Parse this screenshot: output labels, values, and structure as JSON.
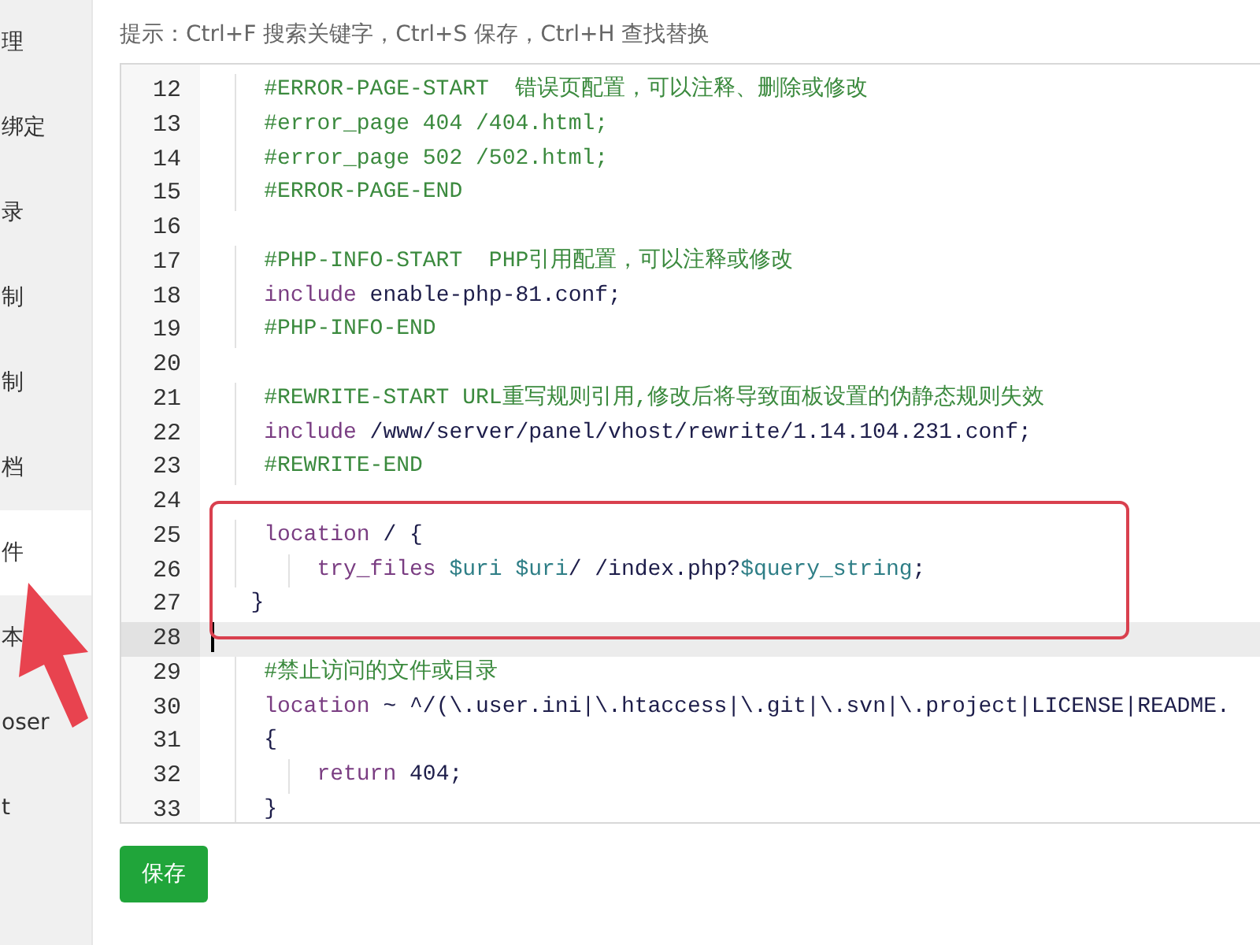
{
  "sidebar": {
    "items": [
      {
        "label": "理",
        "selected": false
      },
      {
        "label": "绑定",
        "selected": false
      },
      {
        "label": "录",
        "selected": false
      },
      {
        "label": "制",
        "selected": false
      },
      {
        "label": "制",
        "selected": false
      },
      {
        "label": "档",
        "selected": false
      },
      {
        "label": "件",
        "selected": true
      },
      {
        "label": "本",
        "selected": false
      },
      {
        "label": "oser",
        "selected": false
      },
      {
        "label": "t",
        "selected": false
      }
    ]
  },
  "hint": "提示：Ctrl+F 搜索关键字，Ctrl+S 保存，Ctrl+H 查找替换",
  "editor": {
    "lines": [
      {
        "number": "12",
        "current": false,
        "tokens": [
          {
            "kind": "comment",
            "text": "    #ERROR-PAGE-START  错误页配置，可以注释、删除或修改"
          }
        ]
      },
      {
        "number": "13",
        "current": false,
        "tokens": [
          {
            "kind": "comment",
            "text": "    #error_page 404 /404.html;"
          }
        ]
      },
      {
        "number": "14",
        "current": false,
        "tokens": [
          {
            "kind": "comment",
            "text": "    #error_page 502 /502.html;"
          }
        ]
      },
      {
        "number": "15",
        "current": false,
        "tokens": [
          {
            "kind": "comment",
            "text": "    #ERROR-PAGE-END"
          }
        ]
      },
      {
        "number": "16",
        "current": false
      },
      {
        "number": "17",
        "current": false,
        "tokens": [
          {
            "kind": "comment",
            "text": "    #PHP-INFO-START  PHP引用配置，可以注释或修改"
          }
        ]
      },
      {
        "number": "18",
        "current": false,
        "tokens": [
          {
            "kind": "keyword",
            "text": "    include"
          },
          {
            "kind": "plain",
            "text": " enable-php-81.conf;"
          }
        ]
      },
      {
        "number": "19",
        "current": false,
        "tokens": [
          {
            "kind": "comment",
            "text": "    #PHP-INFO-END"
          }
        ]
      },
      {
        "number": "20",
        "current": false
      },
      {
        "number": "21",
        "current": false,
        "tokens": [
          {
            "kind": "comment",
            "text": "    #REWRITE-START URL重写规则引用,修改后将导致面板设置的伪静态规则失效"
          }
        ]
      },
      {
        "number": "22",
        "current": false,
        "tokens": [
          {
            "kind": "keyword",
            "text": "    include"
          },
          {
            "kind": "plain",
            "text": " /www/server/panel/vhost/rewrite/1.14.104.231.conf;"
          }
        ]
      },
      {
        "number": "23",
        "current": false,
        "tokens": [
          {
            "kind": "comment",
            "text": "    #REWRITE-END"
          }
        ]
      },
      {
        "number": "24",
        "current": false
      },
      {
        "number": "25",
        "current": false,
        "tokens": [
          {
            "kind": "keyword",
            "text": "    location"
          },
          {
            "kind": "plain",
            "text": " / {"
          }
        ]
      },
      {
        "number": "26",
        "current": false,
        "tokens": [
          {
            "kind": "keyword",
            "text": "        try_files"
          },
          {
            "kind": "variable",
            "text": " $uri"
          },
          {
            "kind": "variable",
            "text": " $uri"
          },
          {
            "kind": "plain",
            "text": "/ /index.php?"
          },
          {
            "kind": "variable",
            "text": "$query_string"
          },
          {
            "kind": "plain",
            "text": ";"
          }
        ]
      },
      {
        "number": "27",
        "current": false,
        "tokens": [
          {
            "kind": "plain",
            "text": "   }"
          }
        ]
      },
      {
        "number": "28",
        "current": true
      },
      {
        "number": "29",
        "current": false,
        "tokens": [
          {
            "kind": "comment",
            "text": "    #禁止访问的文件或目录"
          }
        ]
      },
      {
        "number": "30",
        "current": false,
        "tokens": [
          {
            "kind": "keyword",
            "text": "    location"
          },
          {
            "kind": "plain",
            "text": " ~ ^/(\\.user.ini|\\.htaccess|\\.git|\\.svn|\\.project|LICENSE|README."
          }
        ]
      },
      {
        "number": "31",
        "current": false,
        "tokens": [
          {
            "kind": "plain",
            "text": "    {"
          }
        ]
      },
      {
        "number": "32",
        "current": false,
        "tokens": [
          {
            "kind": "keyword",
            "text": "        return"
          },
          {
            "kind": "plain",
            "text": " 404;"
          }
        ]
      },
      {
        "number": "33",
        "current": false,
        "tokens": [
          {
            "kind": "plain",
            "text": "    }"
          }
        ]
      }
    ]
  },
  "save_button": "保存"
}
